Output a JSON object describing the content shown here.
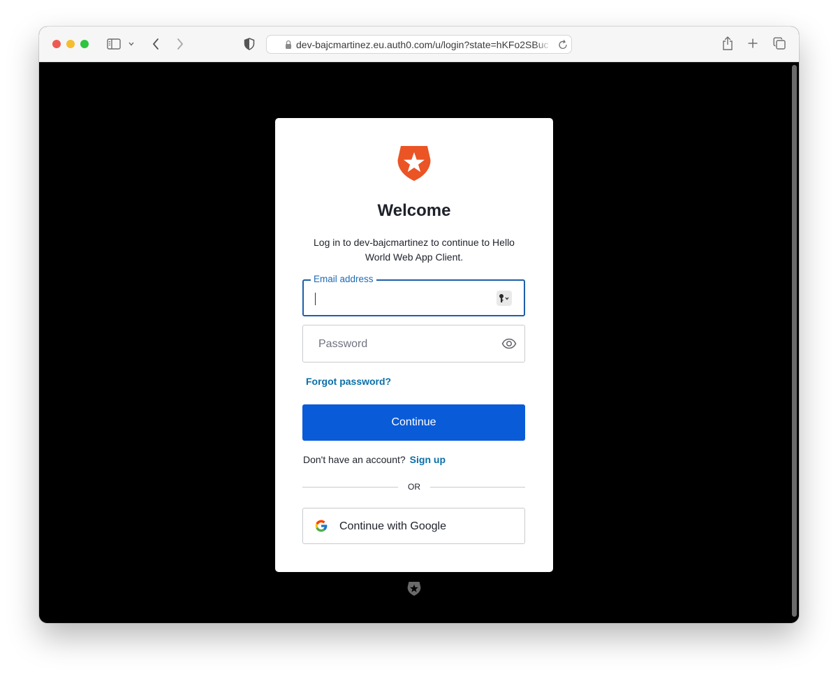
{
  "browser": {
    "url": "dev-bajcmartinez.eu.auth0.com/u/login?state=hKFo2SBucD",
    "icons": [
      "sidebar-icon",
      "chevron-down-icon",
      "back-arrow-icon",
      "forward-arrow-icon",
      "shield-icon",
      "lock-icon",
      "reload-icon",
      "share-icon",
      "plus-icon",
      "tabs-overview-icon"
    ]
  },
  "login": {
    "title": "Welcome",
    "subtitle": "Log in to dev-bajcmartinez to continue to Hello World Web App Client.",
    "email": {
      "label": "Email address",
      "value": ""
    },
    "password": {
      "placeholder": "Password",
      "value": ""
    },
    "forgot_password": "Forgot password?",
    "continue_label": "Continue",
    "signup_prompt": "Don't have an account?",
    "signup_link": "Sign up",
    "divider": "OR",
    "google_label": "Continue with Google"
  },
  "colors": {
    "brand": "#eb5424",
    "primary_button": "#0a5bd8",
    "link": "#0a6fa8",
    "focus_border": "#1d5fa8"
  }
}
